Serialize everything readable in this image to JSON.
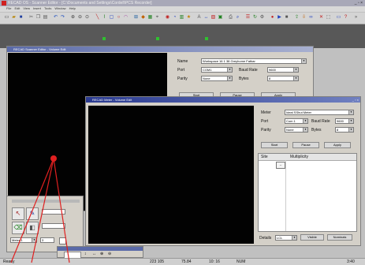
{
  "app": {
    "title": "RECAD OS - Scanner Editor - [C:\\Documents and Settings\\Cordell\\PCS Recorder]"
  },
  "menubar": [
    "File",
    "Edit",
    "View",
    "Insert",
    "Tools",
    "Window",
    "Help"
  ],
  "back_window": {
    "title": "RECAD Scanner Editor - Volume Edit",
    "props": {
      "name_label": "Name",
      "name_value": "Workspace 16 1 38 Greyhome Fatbar",
      "port_label": "Port",
      "port_value": "COM1",
      "baud_label": "Baud Rate",
      "baud_value": "9600",
      "parity_label": "Parity",
      "parity_value": "None",
      "bytes_label": "Bytes",
      "bytes_value": "8",
      "btn_start": "Start",
      "btn_pause": "Pause",
      "btn_apply": "Apply"
    }
  },
  "front_window": {
    "title": "RECAD Meter - Volume Edit",
    "props": {
      "meter_label": "Meter",
      "meter_value": "Ideal SShut Meter",
      "port_label": "Port",
      "port_value": "Com 1",
      "baud_label": "Baud Rate",
      "baud_value": "9600",
      "parity_label": "Parity",
      "parity_value": "None",
      "bytes_label": "Bytes",
      "bytes_value": "8",
      "btn_start": "Start",
      "btn_pause": "Pause",
      "btn_apply": "Apply"
    },
    "table": {
      "col1": "Site",
      "col2": "Multiplicity"
    },
    "bottom": {
      "label": "Details",
      "select_value": "LCL",
      "btn_visible": "Visible",
      "btn_nominals": "Nominals"
    }
  },
  "small_panel": {
    "field1_value": "Meter 1",
    "field2_value": "3"
  },
  "statusbar": {
    "left": "Ready",
    "cells": [
      "223 105",
      "75.84",
      "10: 16",
      "NUM"
    ],
    "right": "3:40"
  },
  "colors": {
    "annotation_red": "#e02020",
    "canvas": "#020202"
  }
}
